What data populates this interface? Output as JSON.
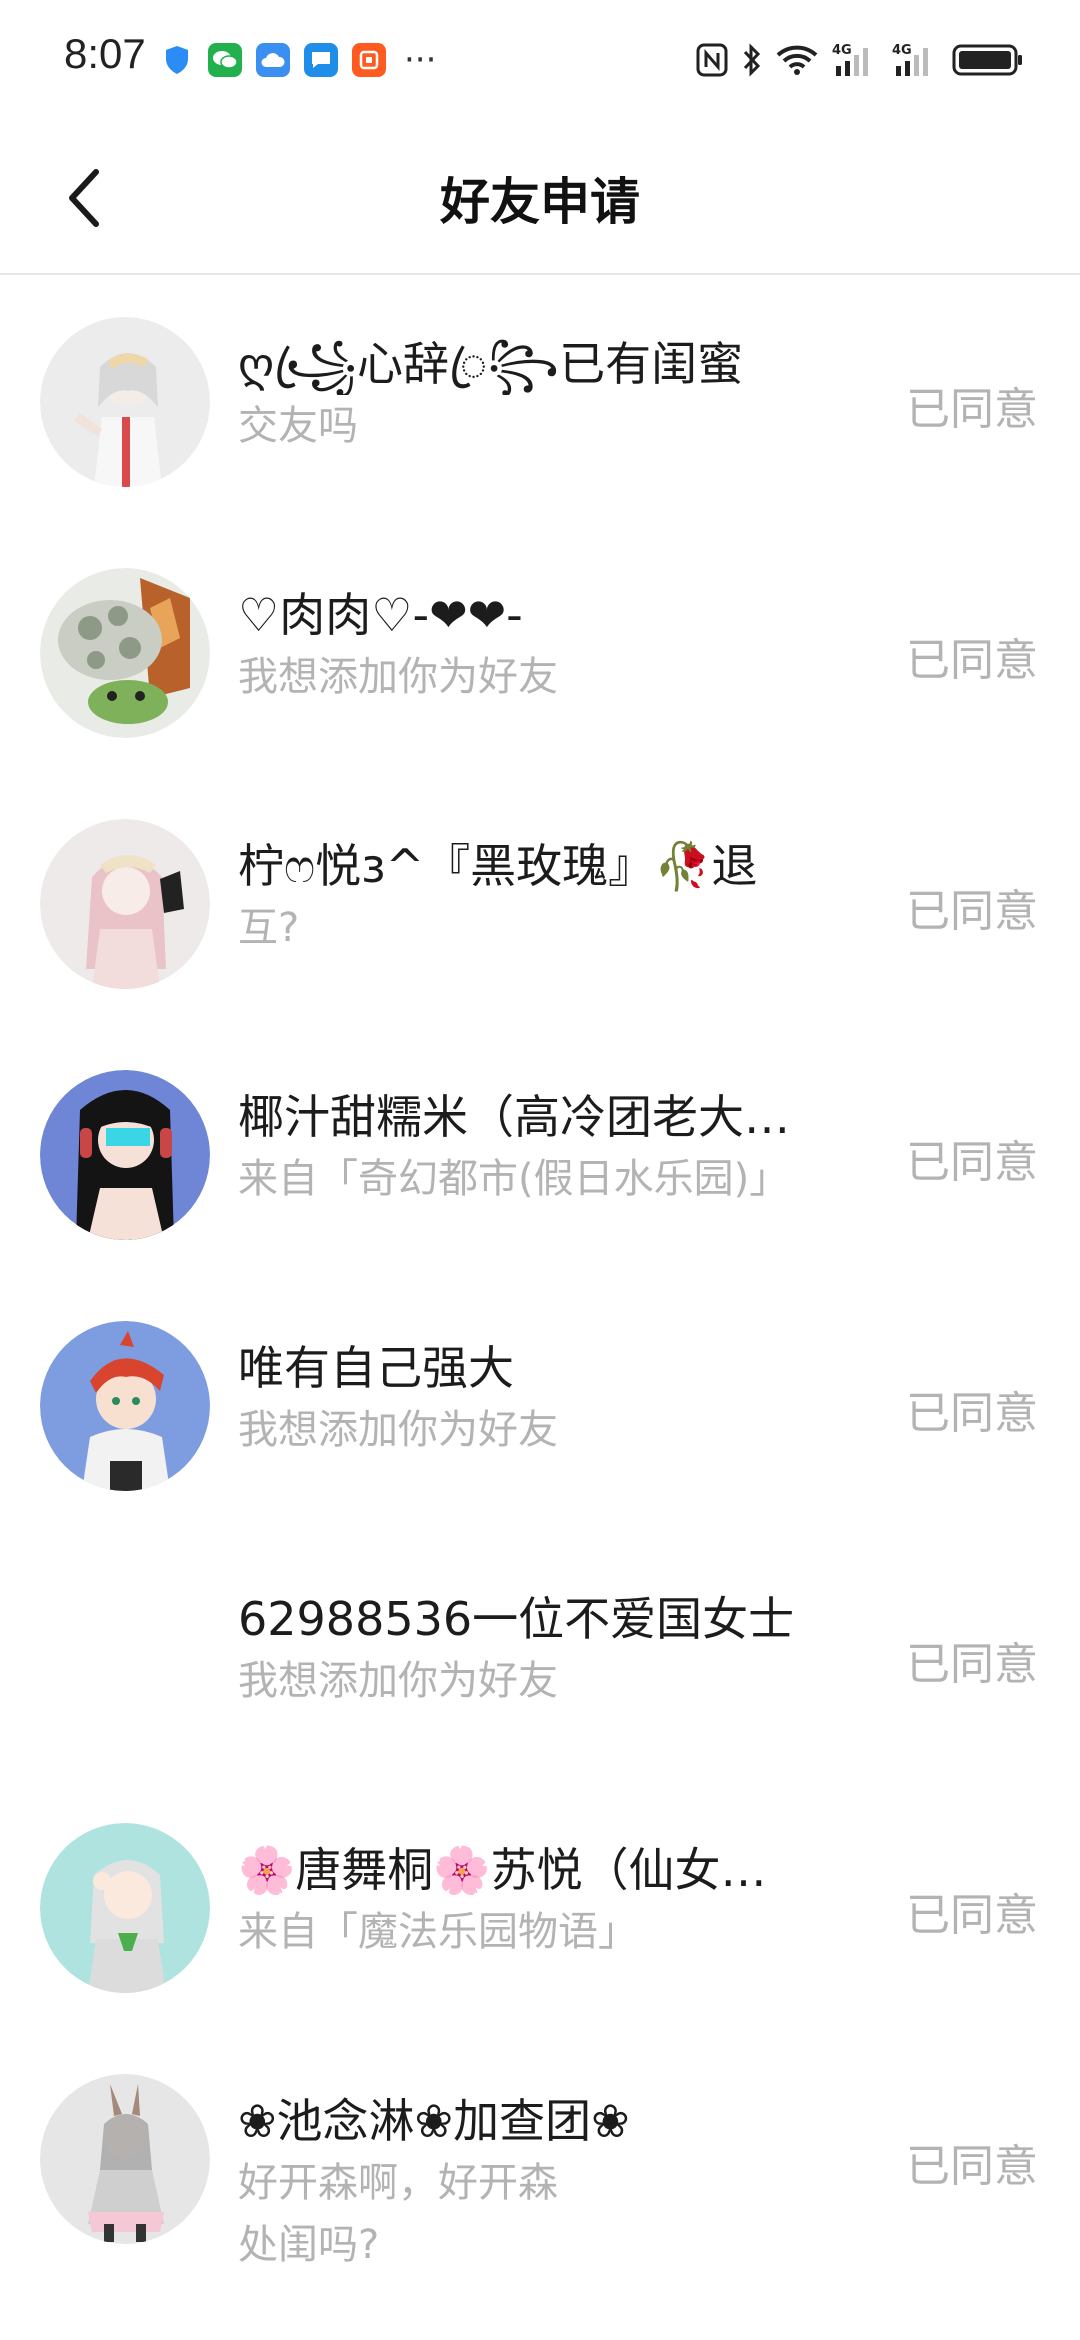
{
  "status_bar": {
    "time": "8:07",
    "more": "···",
    "notif_icons": [
      "shield-icon",
      "wechat-icon",
      "cloud-icon",
      "message-icon",
      "taobao-icon"
    ],
    "sys_icons": [
      "nfc-icon",
      "bluetooth-icon",
      "wifi-icon",
      "signal-4g-icon",
      "signal-4g-icon",
      "battery-icon"
    ],
    "signal_label": "4G"
  },
  "header": {
    "title": "好友申请"
  },
  "requests": [
    {
      "name": "ღ꧁ꦿ心辞ꦿ꧂已有闺蜜",
      "message": "交友吗",
      "status": "已同意",
      "avatar_bg": "#ececec"
    },
    {
      "name": "♡肉肉♡-❤❤-",
      "message": "我想添加你为好友",
      "status": "已同意",
      "avatar_bg": "#e9ece6"
    },
    {
      "name": "柠ෆ悦ɜ^『黑玫瑰』🥀退",
      "message": "互?",
      "status": "已同意",
      "avatar_bg": "#efeaea"
    },
    {
      "name": "椰汁甜糯米（高冷团老大…",
      "message": "来自「奇幻都市(假日水乐园)」",
      "status": "已同意",
      "avatar_bg": "#6f86d6"
    },
    {
      "name": "唯有自己强大",
      "message": "我想添加你为好友",
      "status": "已同意",
      "avatar_bg": "#7e9de0"
    },
    {
      "name": "62988536一位不爱国女士",
      "message": "我想添加你为好友",
      "status": "已同意",
      "avatar_bg": "#ffffff"
    },
    {
      "name": "🌸唐舞桐🌸苏悦（仙女…",
      "message": "来自「魔法乐园物语」",
      "status": "已同意",
      "avatar_bg": "#aee3e0"
    },
    {
      "name": "❀池念淋❀加查团❀",
      "message": "好开森啊，好开森",
      "message2": "处闺吗?",
      "status": "已同意",
      "avatar_bg": "#e6e6e6"
    }
  ]
}
